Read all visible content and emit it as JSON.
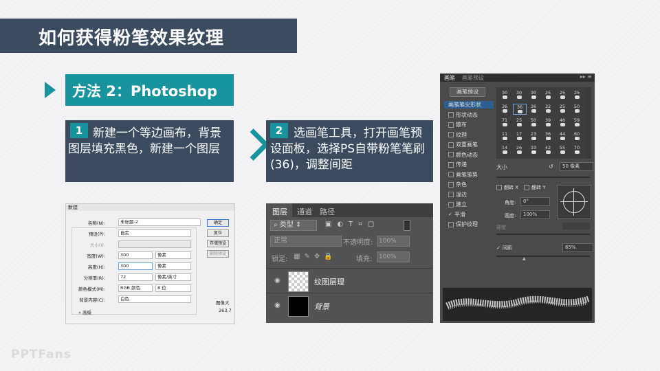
{
  "title": "如何获得粉笔效果纹理",
  "method_label": "方法 2：Photoshop",
  "steps": [
    {
      "num": "1",
      "text": "新建一个等边画布，背景图层填充黑色，新建一个图层"
    },
    {
      "num": "2",
      "text": "选画笔工具，打开画笔预设面板，选择PS自带粉笔笔刷 (36)，调整间距"
    }
  ],
  "new_dialog": {
    "window_title": "新建",
    "name_label": "名称(N):",
    "name_value": "未标题-2",
    "preset_label": "预设(P):",
    "preset_value": "自定",
    "size_label": "大小(I):",
    "width_label": "宽度(W):",
    "width_value": "300",
    "width_unit": "像素",
    "height_label": "高度(H):",
    "height_value": "300",
    "height_unit": "像素",
    "resolution_label": "分辨率(R):",
    "resolution_value": "72",
    "resolution_unit": "像素/英寸",
    "color_mode_label": "颜色模式(M):",
    "color_mode_value": "RGB 颜色",
    "bit_depth": "8 位",
    "bg_label": "背景内容(C):",
    "bg_value": "白色",
    "advanced_label": "高级",
    "buttons": [
      "确定",
      "复位",
      "存储预设",
      "删除预设"
    ],
    "image_size_label": "图像大",
    "image_size_value": "263.7"
  },
  "layers_panel": {
    "tabs": [
      "图层",
      "通道",
      "路径"
    ],
    "filter_label": "类型",
    "blend_mode": "正常",
    "opacity_label": "不透明度:",
    "opacity_value": "100%",
    "lock_label": "锁定:",
    "fill_label": "填充:",
    "fill_value": "100%",
    "layers": [
      {
        "name": "纹图层理"
      },
      {
        "name": "背景"
      }
    ]
  },
  "brush_panel": {
    "tabs": [
      "画笔",
      "画笔预设"
    ],
    "preset_button": "画笔预设",
    "items": [
      {
        "label": "画笔笔尖形状",
        "checked": false,
        "active": true
      },
      {
        "label": "形状动态",
        "checked": false
      },
      {
        "label": "散布",
        "checked": false
      },
      {
        "label": "纹理",
        "checked": false
      },
      {
        "label": "双重画笔",
        "checked": false
      },
      {
        "label": "颜色动态",
        "checked": false
      },
      {
        "label": "传递",
        "checked": false
      },
      {
        "label": "画笔笔势",
        "checked": false
      },
      {
        "label": "杂色",
        "checked": false
      },
      {
        "label": "湿边",
        "checked": false
      },
      {
        "label": "建立",
        "checked": false
      },
      {
        "label": "平滑",
        "checked": true
      },
      {
        "label": "保护纹理",
        "checked": false
      }
    ],
    "brush_sizes": [
      "30",
      "30",
      "30",
      "25",
      "25",
      "25",
      "36",
      "36",
      "36",
      "32",
      "25",
      "50",
      "71",
      "25",
      "50",
      "39",
      "46",
      "59",
      "11",
      "17",
      "23",
      "36",
      "44",
      "60",
      "14",
      "26",
      "33",
      "42",
      "55",
      "70"
    ],
    "size_label": "大小",
    "size_value": "50 像素",
    "flip_x": "翻转 X",
    "flip_y": "翻转 Y",
    "angle_label": "角度:",
    "angle_value": "0°",
    "roundness_label": "圆度:",
    "roundness_value": "100%",
    "hardness_label": "硬度",
    "spacing_label": "间距",
    "spacing_value": "65%"
  },
  "footer_logo": "PPTFans"
}
